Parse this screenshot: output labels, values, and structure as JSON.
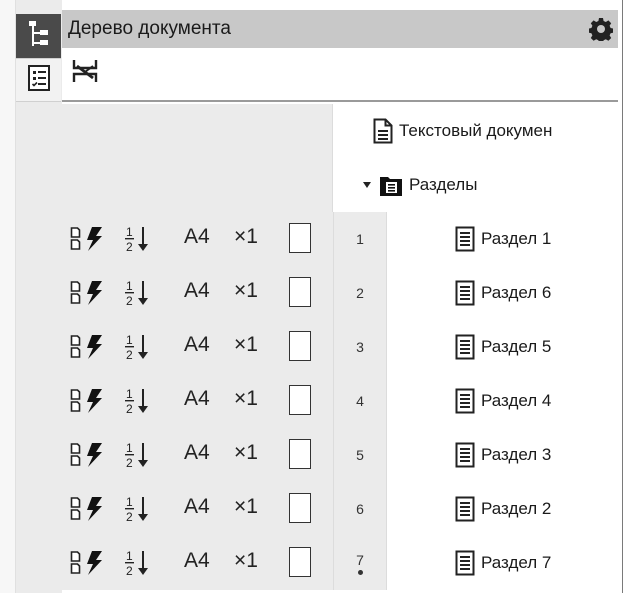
{
  "sidebar": {
    "buttons": [
      {
        "name": "document-tree-tab",
        "icon": "tree-icon",
        "active": true
      },
      {
        "name": "properties-tab",
        "icon": "checklist-icon",
        "active": false
      }
    ]
  },
  "panel": {
    "title": "Дерево документа",
    "settings_icon": "gear-icon",
    "toolbar_icon": "filter-icon"
  },
  "tree": {
    "root_label": "Текстовый докумен",
    "folder_label": "Разделы",
    "sections": [
      {
        "num": "1",
        "label": "Раздел 1",
        "format": "A4",
        "multiplier": "×1"
      },
      {
        "num": "2",
        "label": "Раздел 6",
        "format": "A4",
        "multiplier": "×1"
      },
      {
        "num": "3",
        "label": "Раздел 5",
        "format": "A4",
        "multiplier": "×1"
      },
      {
        "num": "4",
        "label": "Раздел 4",
        "format": "A4",
        "multiplier": "×1"
      },
      {
        "num": "5",
        "label": "Раздел 3",
        "format": "A4",
        "multiplier": "×1"
      },
      {
        "num": "6",
        "label": "Раздел 2",
        "format": "A4",
        "multiplier": "×1"
      },
      {
        "num": "7",
        "label": "Раздел 7",
        "format": "A4",
        "multiplier": "×1"
      }
    ]
  },
  "colors": {
    "title_bar": "#c8c8c8",
    "active_tab": "#4a4a4a",
    "gray_cell": "#ebebeb"
  }
}
